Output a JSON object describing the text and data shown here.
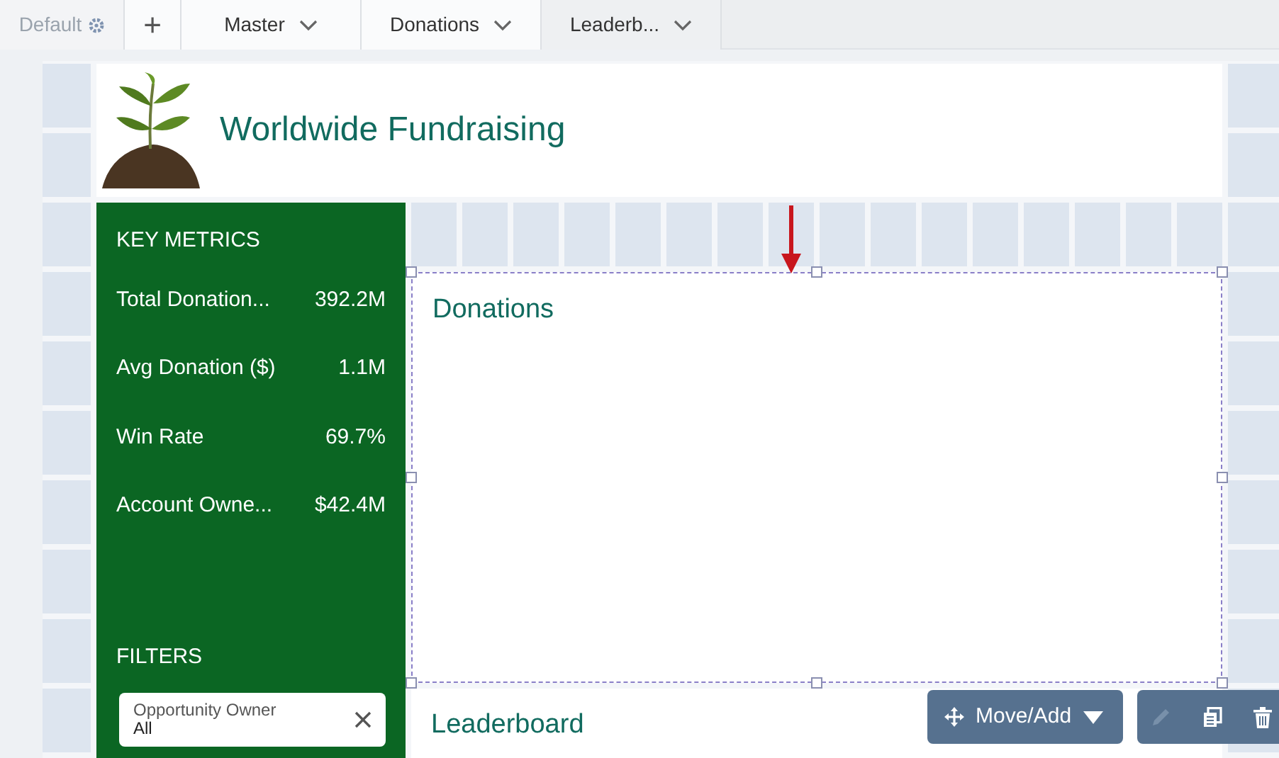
{
  "page_tabs": {
    "default_label": "Default",
    "add_label": "+",
    "pages": [
      {
        "label": "Master",
        "selected": false
      },
      {
        "label": "Donations",
        "selected": false
      },
      {
        "label": "Leaderb...",
        "selected": true
      }
    ]
  },
  "header": {
    "title": "Worldwide Fundraising"
  },
  "key_metrics": {
    "title": "KEY METRICS",
    "metrics": [
      {
        "label": "Total Donation...",
        "value": "392.2M"
      },
      {
        "label": "Avg Donation ($)",
        "value": "1.1M"
      },
      {
        "label": "Win Rate",
        "value": "69.7%"
      },
      {
        "label": "Account Owne...",
        "value": "$42.4M"
      }
    ]
  },
  "filters": {
    "title": "FILTERS",
    "items": [
      {
        "label": "Opportunity Owner",
        "value": "All"
      }
    ]
  },
  "widgets": [
    {
      "title": "Donations",
      "selected": true
    },
    {
      "title": "Leaderboard",
      "selected": false
    }
  ],
  "toolbar": {
    "move_label": "Move/Add",
    "edit_disabled": true
  }
}
